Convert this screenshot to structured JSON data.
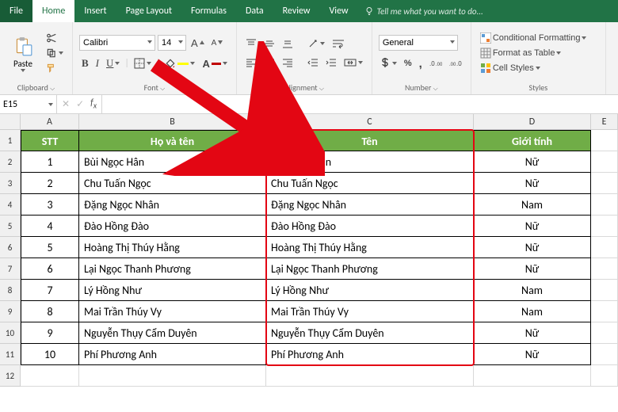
{
  "tabs": {
    "file": "File",
    "home": "Home",
    "insert": "Insert",
    "pageLayout": "Page Layout",
    "formulas": "Formulas",
    "data": "Data",
    "review": "Review",
    "view": "View",
    "tellMe": "Tell me what you want to do..."
  },
  "ribbon": {
    "clipboard": {
      "paste": "Paste",
      "label": "Clipboard"
    },
    "font": {
      "family": "Calibri",
      "size": "14",
      "label": "Font"
    },
    "alignment": {
      "label": "Alignment"
    },
    "number": {
      "format": "General",
      "label": "Number"
    },
    "styles": {
      "cond": "Conditional Formatting",
      "table": "Format as Table",
      "cell": "Cell Styles",
      "label": "Styles"
    }
  },
  "nameBox": "E15",
  "colHeaders": {
    "A": "A",
    "B": "B",
    "C": "C",
    "D": "D",
    "E": "E"
  },
  "headers": {
    "stt": "STT",
    "hoten": "Họ và tên",
    "ten": "Tên",
    "gioitinh": "Giới tính"
  },
  "rows": [
    {
      "stt": "1",
      "hoten": "Bùi Ngọc Hân",
      "ten": "Bùi Ngọc Hân",
      "gt": "Nữ"
    },
    {
      "stt": "2",
      "hoten": "Chu Tuấn Ngọc",
      "ten": "Chu Tuấn Ngọc",
      "gt": "Nữ"
    },
    {
      "stt": "3",
      "hoten": "Đặng Ngọc Nhân",
      "ten": "Đặng Ngọc Nhân",
      "gt": "Nam"
    },
    {
      "stt": "4",
      "hoten": "Đào Hồng Đào",
      "ten": "Đào Hồng Đào",
      "gt": "Nữ"
    },
    {
      "stt": "5",
      "hoten": "Hoàng Thị Thúy Hằng",
      "ten": "Hoàng Thị Thúy Hằng",
      "gt": "Nữ"
    },
    {
      "stt": "6",
      "hoten": "Lại Ngọc Thanh Phương",
      "ten": "Lại Ngọc Thanh Phương",
      "gt": "Nữ"
    },
    {
      "stt": "7",
      "hoten": "Lý Hồng Như",
      "ten": "Lý Hồng Như",
      "gt": "Nam"
    },
    {
      "stt": "8",
      "hoten": "Mai Trần Thúy Vy",
      "ten": "Mai Trần Thúy Vy",
      "gt": "Nam"
    },
    {
      "stt": "9",
      "hoten": "Nguyễn Thụy Cẩm Duyên",
      "ten": "Nguyễn Thụy Cẩm Duyên",
      "gt": "Nữ"
    },
    {
      "stt": "10",
      "hoten": "Phí Phương Anh",
      "ten": "Phí Phương Anh",
      "gt": "Nữ"
    }
  ]
}
